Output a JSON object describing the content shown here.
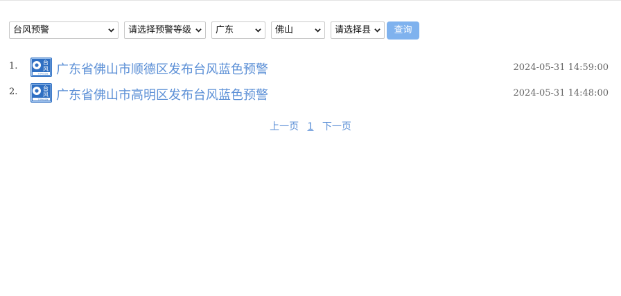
{
  "filters": {
    "warning_type": "台风预警",
    "warning_level": "请选择预警等级",
    "province": "广东",
    "city": "佛山",
    "county": "请选择县",
    "query_label": "查询"
  },
  "warnings": [
    {
      "index": "1.",
      "title": "广东省佛山市顺德区发布台风蓝色预警",
      "time": "2024-05-31 14:59:00",
      "icon": "typhoon-blue-icon"
    },
    {
      "index": "2.",
      "title": "广东省佛山市高明区发布台风蓝色预警",
      "time": "2024-05-31 14:48:00",
      "icon": "typhoon-blue-icon"
    }
  ],
  "icon_text": {
    "line1": "台",
    "line2": "风",
    "caption": "TYPHOON"
  },
  "pager": {
    "prev": "上一页",
    "current": "1",
    "next": "下一页"
  },
  "colors": {
    "accent": "#5b8fd6",
    "button": "#7fb2ee",
    "icon_blue": "#2f6fc2"
  }
}
